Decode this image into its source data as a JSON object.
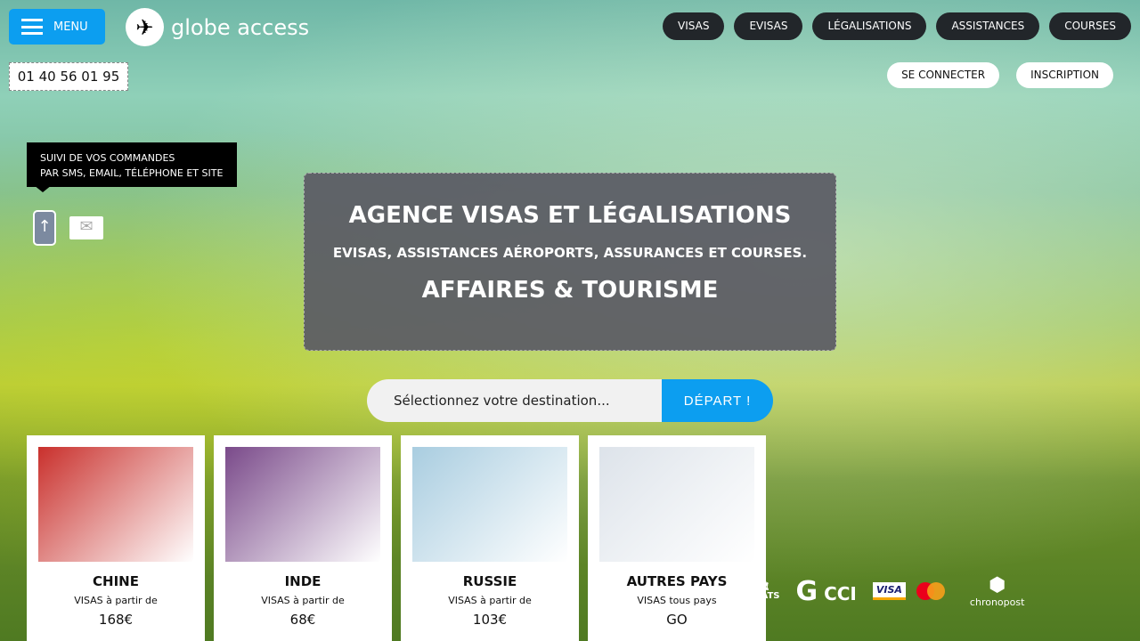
{
  "header": {
    "menu_label": "MENU",
    "logo_text": "globe access",
    "nav": [
      "VISAS",
      "EVISAS",
      "LÉGALISATIONS",
      "ASSISTANCES",
      "COURSES"
    ],
    "phone": "01 40 56 01 95",
    "login": "SE CONNECTER",
    "signup": "INSCRIPTION"
  },
  "tooltip": {
    "line1": "SUIVI DE VOS COMMANDES",
    "line2": "PAR SMS, EMAIL, TÉLÉPHONE ET SITE"
  },
  "hero": {
    "title": "AGENCE VISAS ET LÉGALISATIONS",
    "subtitle": "EVISAS, ASSISTANCES AÉROPORTS, ASSURANCES ET COURSES.",
    "tagline": "AFFAIRES & TOURISME"
  },
  "search": {
    "value": "Sélectionnez votre destination...",
    "button": "DÉPART !"
  },
  "cards": [
    {
      "title": "CHINE",
      "sub": "VISAS à partir de",
      "price": "168€",
      "color": "#c9302c"
    },
    {
      "title": "INDE",
      "sub": "VISAS à partir de",
      "price": "68€",
      "color": "#7a4a8a"
    },
    {
      "title": "RUSSIE",
      "sub": "VISAS à partir de",
      "price": "103€",
      "color": "#a9cde0"
    },
    {
      "title": "AUTRES PAYS",
      "sub": "VISAS tous pays",
      "price": "GO",
      "color": "#dde3ea"
    }
  ],
  "partners": {
    "consulats": "ULATS",
    "cci": "CCI",
    "visa": "VISA",
    "chronopost": "chronopost"
  }
}
